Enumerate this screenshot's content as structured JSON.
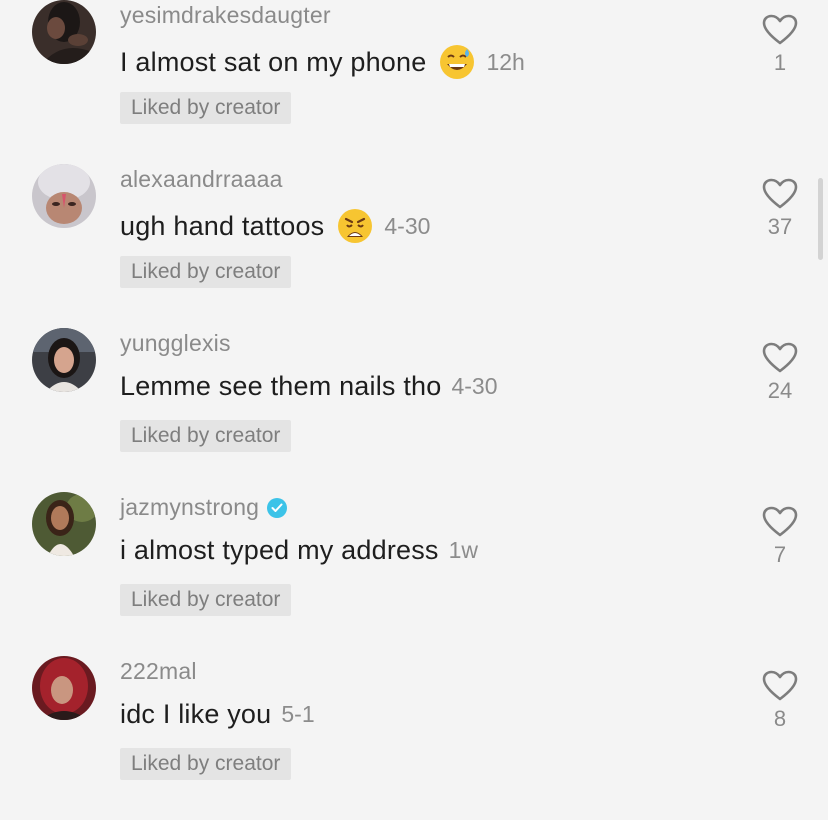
{
  "comments": [
    {
      "username": "yesimdrakesdaugter",
      "text": "I almost sat on my phone",
      "emoji": "grinning-sweat-emoji",
      "timestamp": "12h",
      "badge": "Liked by creator",
      "likes": "1",
      "verified": false,
      "avatar": "avatar-dark"
    },
    {
      "username": "alexaandrraaaa",
      "text": "ugh hand tattoos",
      "emoji": "weary-face-emoji",
      "timestamp": "4-30",
      "badge": "Liked by creator",
      "likes": "37",
      "verified": false,
      "avatar": "avatar-light"
    },
    {
      "username": "yungglexis",
      "text": "Lemme see them nails tho",
      "emoji": "",
      "timestamp": "4-30",
      "badge": "Liked by creator",
      "likes": "24",
      "verified": false,
      "avatar": "avatar-car"
    },
    {
      "username": "jazmynstrong",
      "text": "i almost typed my address",
      "emoji": "",
      "timestamp": "1w",
      "badge": "Liked by creator",
      "likes": "7",
      "verified": true,
      "avatar": "avatar-outdoor"
    },
    {
      "username": "222mal",
      "text": "idc I like you",
      "emoji": "",
      "timestamp": "5-1",
      "badge": "Liked by creator",
      "likes": "8",
      "verified": false,
      "avatar": "avatar-red"
    }
  ],
  "colors": {
    "background": "#f4f4f4",
    "badge_bg": "#e4e4e4",
    "muted_text": "#8a8a8a",
    "verified": "#3cc3e8"
  }
}
